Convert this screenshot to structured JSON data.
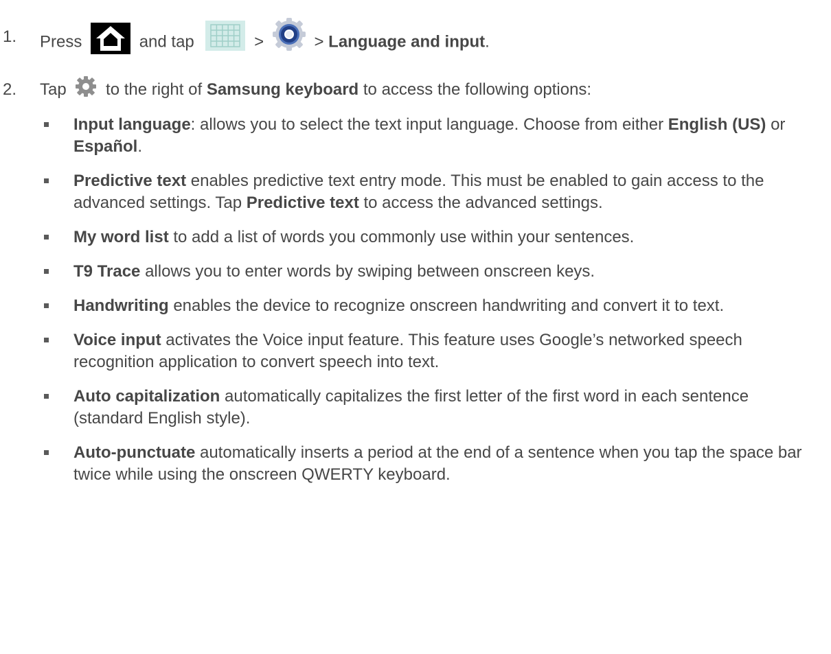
{
  "step1": {
    "number": "1.",
    "press": "Press",
    "and_tap": "and tap",
    "sep1": ">",
    "sep2": ">",
    "destination": "Language and input",
    "end": "."
  },
  "step2": {
    "number": "2.",
    "tap": "Tap",
    "middle": "to the right of",
    "keyboard": "Samsung keyboard",
    "rest": "to access the following options:"
  },
  "icons": {
    "home": "home-icon",
    "apps": "apps-icon",
    "settings": "settings-gear-icon",
    "keyboard_settings": "keyboard-settings-icon"
  },
  "options": [
    {
      "term": "Input language",
      "text_a": ": allows you to select the text input language. Choose from either ",
      "bold_b": "English (US)",
      "text_b": " or ",
      "bold_c": "Español",
      "text_c": "."
    },
    {
      "term": "Predictive text",
      "text_a": " enables predictive text entry mode. This must be enabled to gain access to the advanced settings. Tap ",
      "bold_b": "Predictive text",
      "text_b": " to access the advanced settings."
    },
    {
      "term": "My word list",
      "text": " to add a list of words you commonly use within your sentences."
    },
    {
      "term": "T9 Trace",
      "text": " allows you to enter words by swiping between onscreen keys."
    },
    {
      "term": "Handwriting",
      "text": " enables the device to recognize onscreen handwriting and convert it to text."
    },
    {
      "term": "Voice input",
      "text": " activates the Voice input feature. This feature uses Google’s networked speech recognition application to convert speech into text."
    },
    {
      "term": "Auto capitalization",
      "text": " automatically capitalizes the first letter of the first word in each sentence (standard English style)."
    },
    {
      "term": "Auto-punctuate",
      "text": " automatically inserts a period at the end of a sentence when you tap the space bar twice while using the onscreen QWERTY keyboard."
    }
  ]
}
